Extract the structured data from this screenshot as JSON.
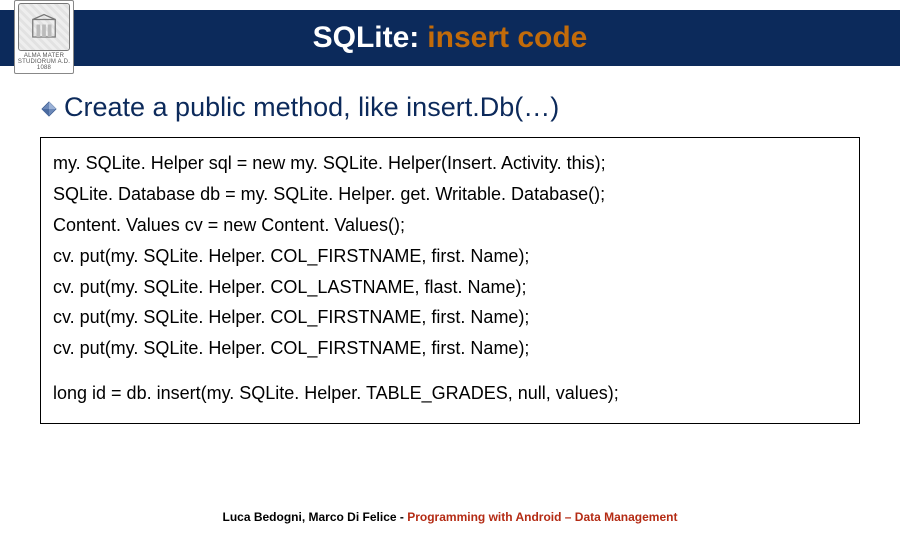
{
  "header": {
    "title_prefix": "SQLite:",
    "title_accent": "insert code",
    "logo_caption": "ALMA MATER STUDIORUM A.D. 1088"
  },
  "bullet": {
    "text": "Create a public method, like insert.Db(…)"
  },
  "code": {
    "lines": [
      "my. SQLite. Helper sql = new my. SQLite. Helper(Insert. Activity. this);",
      "SQLite. Database db = my. SQLite. Helper. get. Writable. Database();",
      "Content. Values cv = new Content. Values();",
      "cv. put(my. SQLite. Helper. COL_FIRSTNAME, first. Name);",
      "cv. put(my. SQLite. Helper. COL_LASTNAME, flast. Name);",
      "cv. put(my. SQLite. Helper. COL_FIRSTNAME, first. Name);",
      "cv. put(my. SQLite. Helper. COL_FIRSTNAME, first. Name);"
    ],
    "tail": "long id = db. insert(my. SQLite. Helper. TABLE_GRADES, null, values);"
  },
  "footer": {
    "authors": "Luca Bedogni, Marco Di Felice",
    "separator": " - ",
    "course": "Programming with Android – Data Management"
  }
}
